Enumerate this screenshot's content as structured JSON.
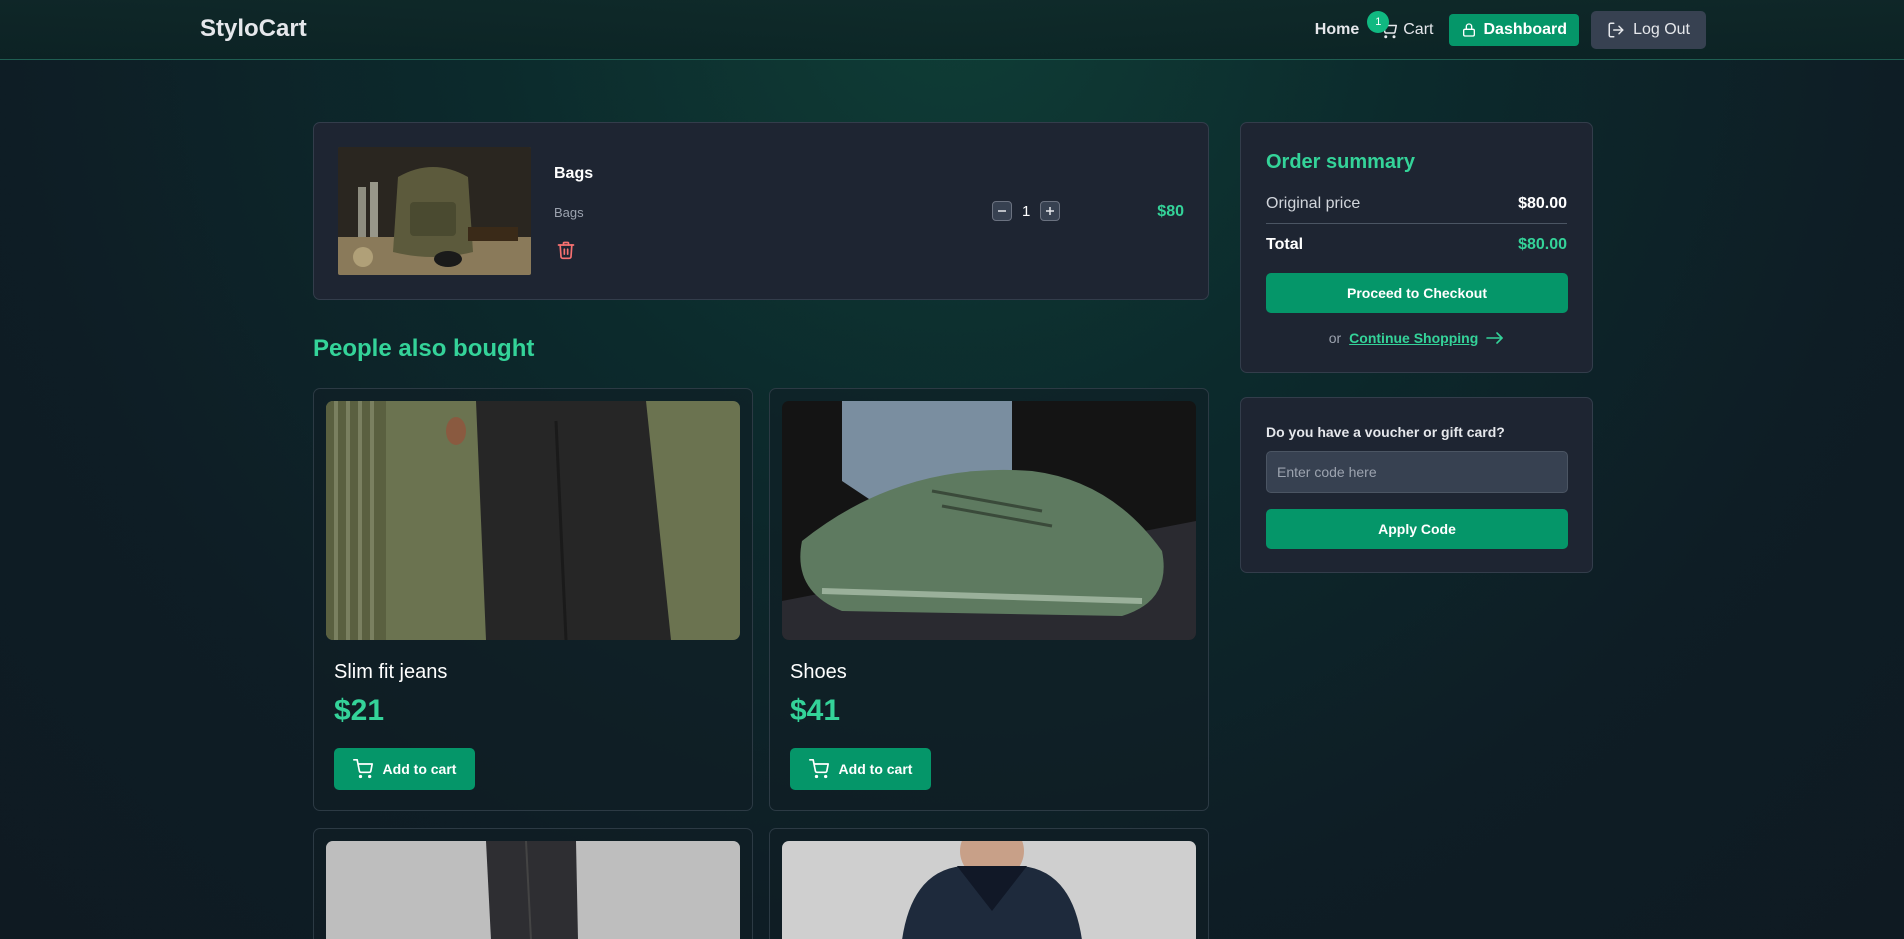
{
  "header": {
    "brand": "StyloCart",
    "home": "Home",
    "cart": "Cart",
    "cart_count": "1",
    "dashboard": "Dashboard",
    "logout": "Log Out"
  },
  "cart_item": {
    "name": "Bags",
    "category": "Bags",
    "quantity": "1",
    "price": "$80",
    "image_icon": "backpack-photo"
  },
  "recommendations": {
    "title": "People also bought",
    "products": [
      {
        "name": "Slim fit jeans",
        "price": "$21",
        "button": "Add to cart"
      },
      {
        "name": "Shoes",
        "price": "$41",
        "button": "Add to cart"
      },
      {
        "name": "",
        "price": "",
        "button": ""
      },
      {
        "name": "",
        "price": "",
        "button": ""
      }
    ]
  },
  "summary": {
    "title": "Order summary",
    "original_label": "Original price",
    "original_value": "$80.00",
    "total_label": "Total",
    "total_value": "$80.00",
    "checkout": "Proceed to Checkout",
    "or": "or",
    "continue": "Continue Shopping"
  },
  "voucher": {
    "label": "Do you have a voucher or gift card?",
    "placeholder": "Enter code here",
    "apply": "Apply Code"
  },
  "colors": {
    "accent": "#059669",
    "accent_text": "#34d399",
    "danger": "#f87171",
    "panel": "#1e2532"
  }
}
